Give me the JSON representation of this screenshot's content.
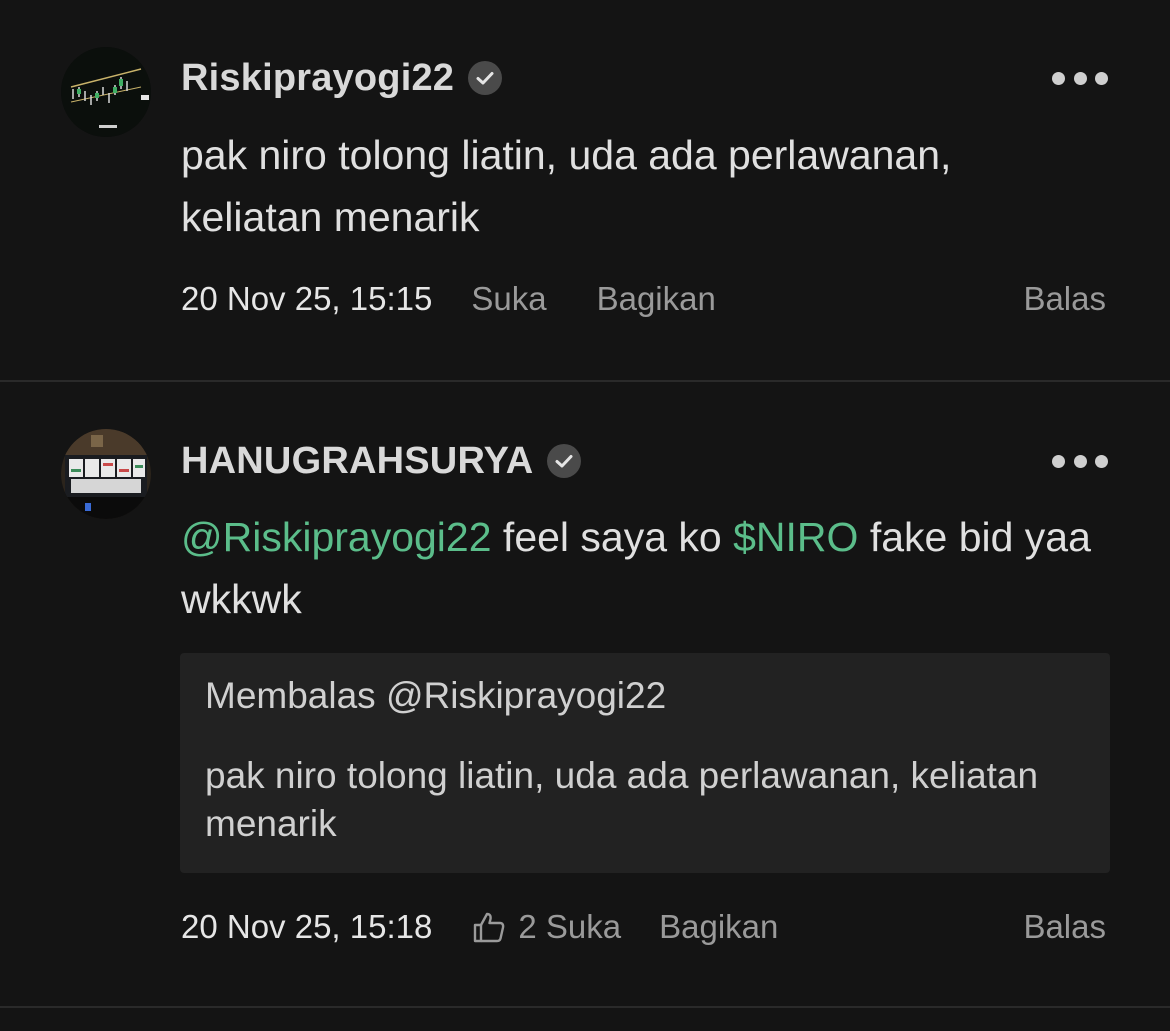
{
  "comments": [
    {
      "username": "Riskiprayogi22",
      "verified": true,
      "body": "pak niro tolong liatin, uda ada perlawanan, keliatan menarik",
      "timestamp": "20 Nov 25, 15:15",
      "like_label": "Suka",
      "share_label": "Bagikan",
      "reply_label": "Balas"
    },
    {
      "username": "HANUGRAHSURYA",
      "verified": true,
      "body_parts": {
        "mention": "@Riskiprayogi22",
        "text_a": " feel saya ko ",
        "ticker": "$NIRO",
        "text_b": " fake bid yaa wkkwk"
      },
      "quote": {
        "header": "Membalas @Riskiprayogi22",
        "text": "pak niro tolong liatin, uda ada perlawanan, keliatan menarik"
      },
      "timestamp": "20 Nov 25, 15:18",
      "like_count_label": "2 Suka",
      "share_label": "Bagikan",
      "reply_label": "Balas"
    }
  ],
  "colors": {
    "background": "#141414",
    "accent_green": "#5bbd8a",
    "muted": "#9a9a9a",
    "quote_bg": "#222222"
  },
  "icons": {
    "verified": "verified-badge-icon",
    "more": "more-options-icon",
    "like": "thumbs-up-icon"
  }
}
